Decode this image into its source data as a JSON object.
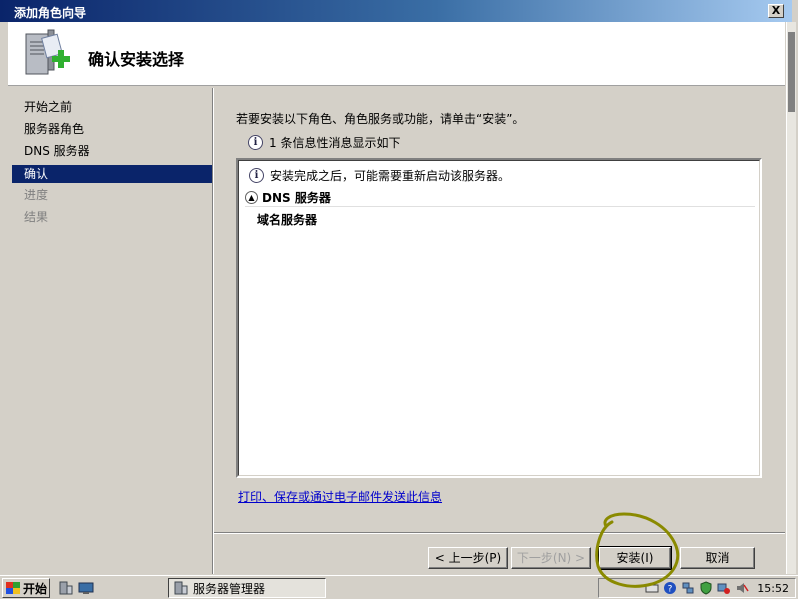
{
  "window": {
    "title": "添加角色向导",
    "close_label": "X"
  },
  "header": {
    "page_title": "确认安装选择"
  },
  "nav": {
    "items": [
      {
        "label": "开始之前",
        "state": "normal"
      },
      {
        "label": "服务器角色",
        "state": "normal"
      },
      {
        "label": "DNS 服务器",
        "state": "normal"
      },
      {
        "label": "确认",
        "state": "active"
      },
      {
        "label": "进度",
        "state": "disabled"
      },
      {
        "label": "结果",
        "state": "disabled"
      }
    ]
  },
  "content": {
    "instruction": "若要安装以下角色、角色服务或功能，请单击“安装”。",
    "info_count": "1 条信息性消息显示如下",
    "box": {
      "note": "安装完成之后，可能需要重新启动该服务器。",
      "section_title": "DNS 服务器",
      "section_item": "域名服务器"
    },
    "print_link": "打印、保存或通过电子邮件发送此信息"
  },
  "buttons": {
    "back": "< 上一步(P)",
    "next": "下一步(N) >",
    "install": "安装(I)",
    "cancel": "取消"
  },
  "taskbar": {
    "start": "开始",
    "task_label": "服务器管理器",
    "clock": "15:52"
  },
  "colors": {
    "highlight": "#0a246a",
    "link": "#0000cc",
    "annotation": "#8a8a00"
  }
}
